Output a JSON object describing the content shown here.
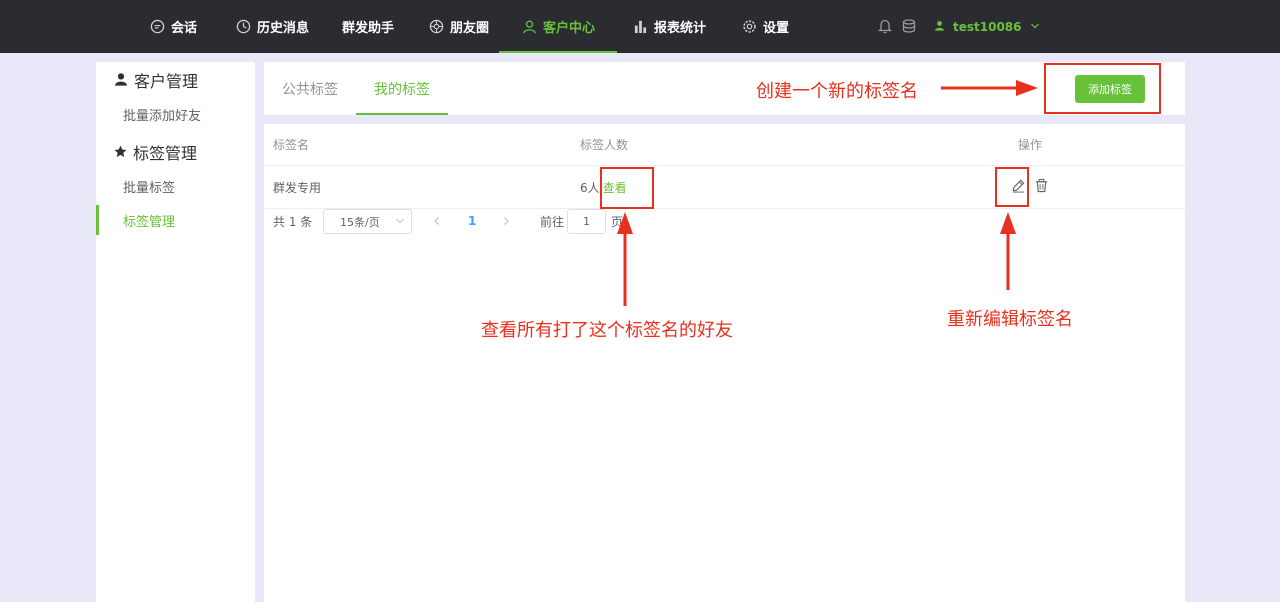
{
  "nav": {
    "items": [
      {
        "label": "会话",
        "icon": "chat-icon"
      },
      {
        "label": "历史消息",
        "icon": "clock-icon"
      },
      {
        "label": "群发助手",
        "icon": ""
      },
      {
        "label": "朋友圈",
        "icon": "aperture-icon"
      },
      {
        "label": "客户中心",
        "icon": "user-icon",
        "active": true
      },
      {
        "label": "报表统计",
        "icon": "bar-chart-icon"
      },
      {
        "label": "设置",
        "icon": "gear-icon"
      }
    ],
    "username": "test10086"
  },
  "sidebar": {
    "group1": "客户管理",
    "group1_items": [
      "批量添加好友"
    ],
    "group2": "标签管理",
    "group2_items": [
      "批量标签",
      "标签管理"
    ]
  },
  "tabs": {
    "items": [
      "公共标签",
      "我的标签"
    ],
    "active": 1,
    "add_label": "添加标签"
  },
  "table": {
    "headers": [
      "标签名",
      "标签人数",
      "操作"
    ],
    "rows": [
      {
        "name": "群发专用",
        "count": "6人",
        "view": "查看"
      }
    ]
  },
  "pagination": {
    "total": "共 1 条",
    "page_size": "15条/页",
    "current": "1",
    "goto_prefix": "前往",
    "goto_value": "1",
    "goto_suffix": "页"
  },
  "annotations": {
    "create": "创建一个新的标签名",
    "view": "查看所有打了这个标签名的好友",
    "edit": "重新编辑标签名"
  },
  "colors": {
    "accent": "#67c23a",
    "topbar": "#2a2c32",
    "annotation": "#e8301f"
  }
}
